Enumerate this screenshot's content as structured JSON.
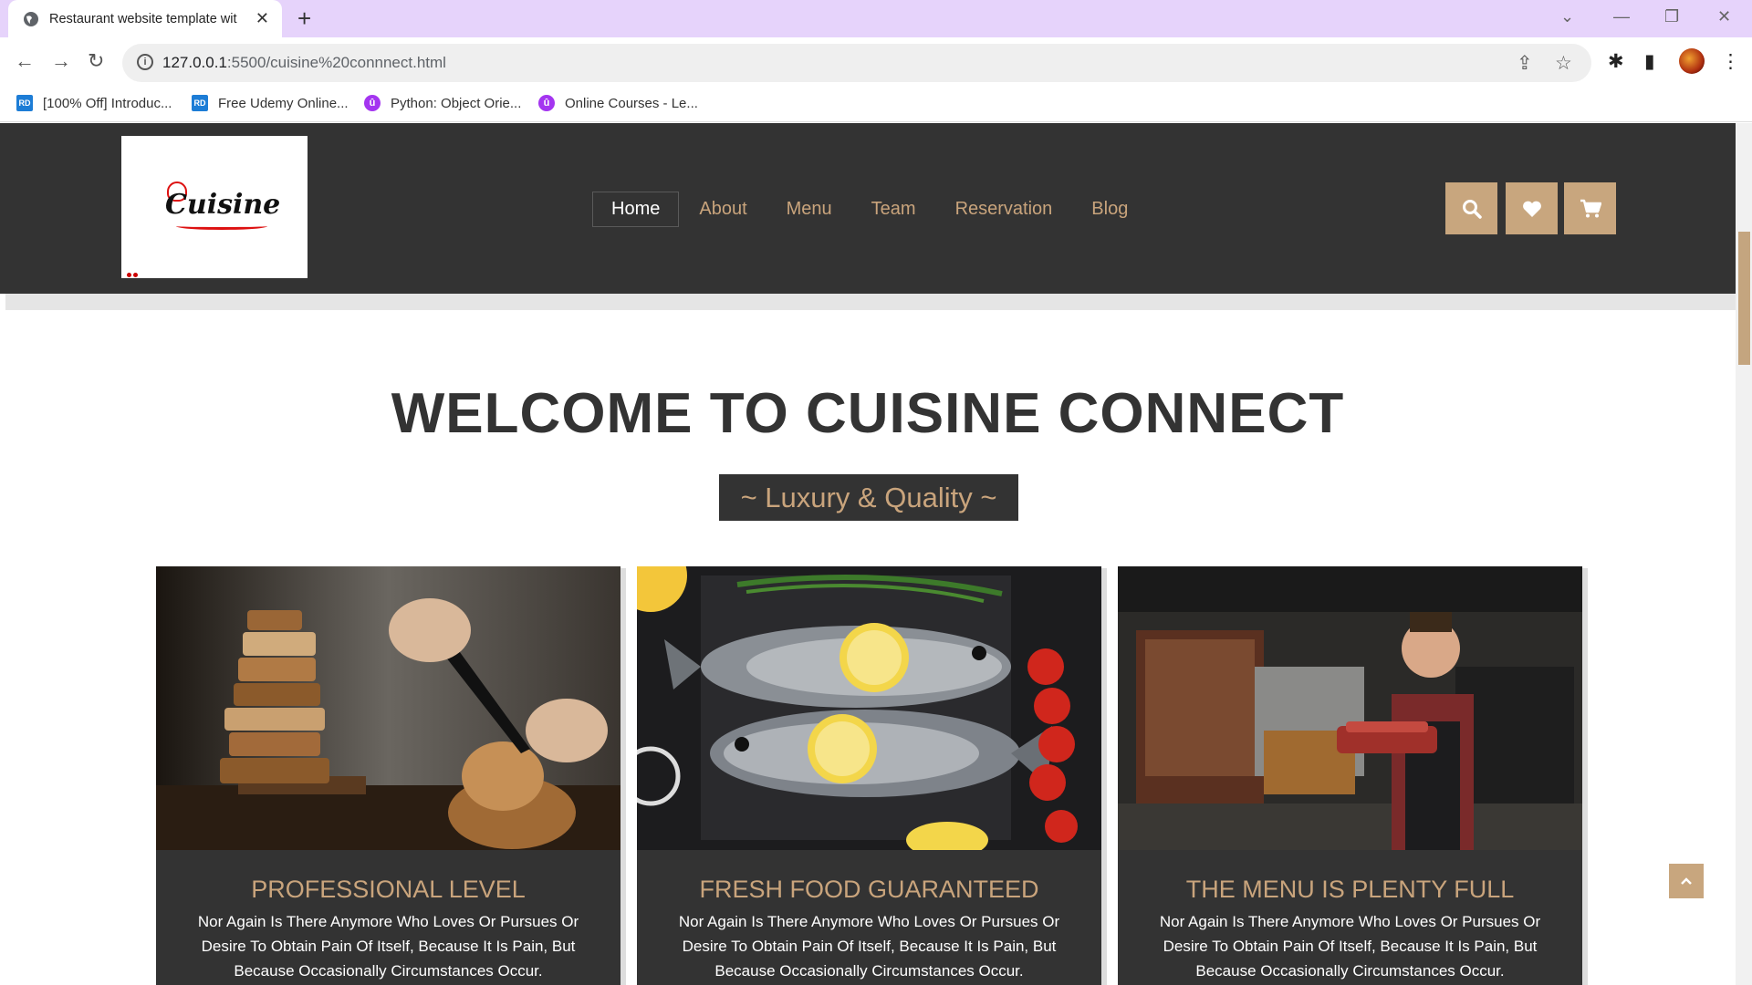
{
  "browser": {
    "tab_title": "Restaurant website template wit",
    "url_host": "127.0.0.1",
    "url_path": ":5500/cuisine%20connnect.html",
    "bookmarks": [
      {
        "label": "[100% Off] Introduc...",
        "icon": "rd"
      },
      {
        "label": "Free Udemy Online...",
        "icon": "rd"
      },
      {
        "label": "Python: Object Orie...",
        "icon": "udemy"
      },
      {
        "label": "Online Courses - Le...",
        "icon": "udemy"
      }
    ],
    "rd_badge": "RD",
    "udemy_badge": "û"
  },
  "site": {
    "logo_text": "Cuisine",
    "nav": [
      {
        "label": "Home",
        "active": true
      },
      {
        "label": "About"
      },
      {
        "label": "Menu"
      },
      {
        "label": "Team"
      },
      {
        "label": "Reservation"
      },
      {
        "label": "Blog"
      }
    ],
    "header_icons": [
      "search-icon",
      "heart-icon",
      "cart-icon"
    ],
    "accent_color": "#c8a67e",
    "dark_color": "#333333"
  },
  "hero": {
    "title": "WELCOME TO CUISINE CONNECT",
    "subtitle": "~ Luxury & Quality ~"
  },
  "cards": [
    {
      "title": "PROFESSIONAL LEVEL",
      "text": "Nor Again Is There Anymore Who Loves Or Pursues Or Desire To Obtain Pain Of Itself, Because It Is Pain, But Because Occasionally Circumstances Occur.",
      "image": "bread-cutting-photo"
    },
    {
      "title": "FRESH FOOD GUARANTEED",
      "text": "Nor Again Is There Anymore Who Loves Or Pursues Or Desire To Obtain Pain Of Itself, Because It Is Pain, But Because Occasionally Circumstances Occur.",
      "image": "fish-lemon-photo"
    },
    {
      "title": "THE MENU IS PLENTY FULL",
      "text": "Nor Again Is There Anymore Who Loves Or Pursues Or Desire To Obtain Pain Of Itself, Because It Is Pain, But Because Occasionally Circumstances Occur.",
      "image": "chef-kitchen-photo"
    }
  ]
}
